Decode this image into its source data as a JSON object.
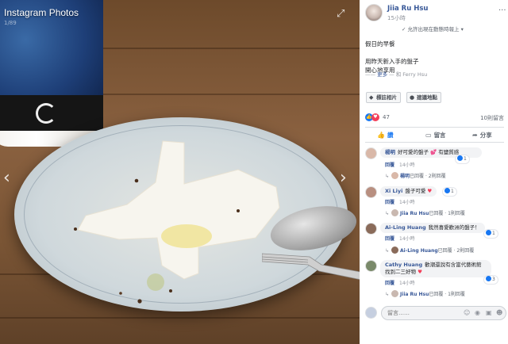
{
  "viewer": {
    "title": "Instagram Photos",
    "subtitle": "1/89",
    "expand_icon": "expand-icon",
    "prev_icon": "chevron-left-icon",
    "next_icon": "chevron-right-icon"
  },
  "post": {
    "author": "Jiia Ru Hsu",
    "time": "15小時",
    "privacy": "允許出現在動態時報上",
    "caption_line1": "假日的早餐",
    "caption_line2": "用昨天新入手的盤子",
    "caption_line3": "開心地享用",
    "meta_prefix": "——",
    "meta_more": "更多",
    "meta_with": "— 和 Ferry Hsu",
    "tag_photo": "標註相片",
    "add_location": "建議地點",
    "reaction_count": "47",
    "comment_count": "10則留言",
    "like_label": "讚",
    "comment_label": "留言",
    "share_label": "分享"
  },
  "comments": [
    {
      "name": "楊明",
      "text": "好可愛的盤子",
      "text2": "有鹽質感",
      "time": "14小時",
      "reply_link": "回覆",
      "badge": "1",
      "reply_author": "楊明",
      "reply_text": "已回覆",
      "reply_count": "2則回覆"
    },
    {
      "name": "Xi Liyi",
      "text": "盤子可愛",
      "time": "14小時",
      "reply_link": "回覆",
      "badge": "1",
      "reply_author": "Jiia Ru Hsu",
      "reply_text": "已回覆",
      "reply_count": "1則回覆"
    },
    {
      "name": "Ai-Ling Huang",
      "text": "我然喜愛歡洲的盤子！",
      "time": "14小時",
      "reply_link": "回覆",
      "badge": "1",
      "reply_author": "Ai-Ling Huang",
      "reply_text": "已回覆",
      "reply_count": "2則回覆"
    },
    {
      "name": "Cathy Huang",
      "text": "歡潮還說有含當代藝術館",
      "text2": "找到二三好物",
      "time": "14小時",
      "reply_link": "回覆",
      "badge": "3",
      "reply_author": "Jiia Ru Hsu",
      "reply_text": "已回覆",
      "reply_count": "1則回覆"
    }
  ],
  "composer": {
    "placeholder": "留言……"
  },
  "colors": {
    "link": "#385898",
    "like_blue": "#1877f2",
    "love_red": "#f33e58"
  }
}
